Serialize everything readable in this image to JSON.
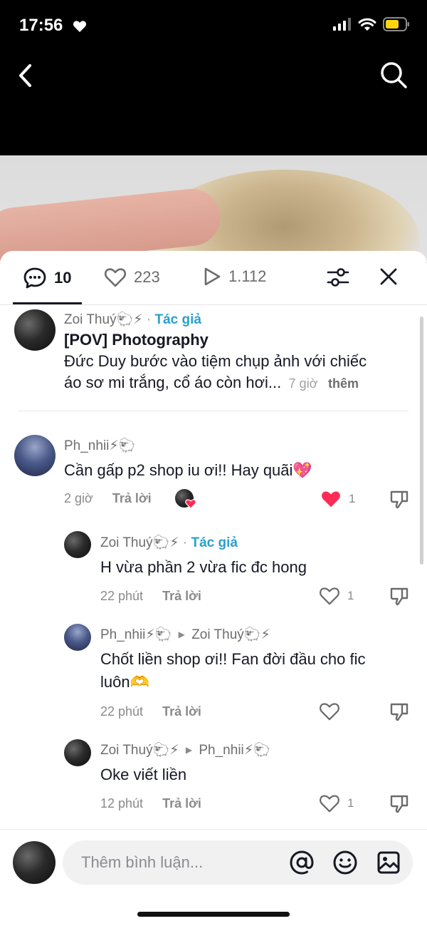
{
  "status_bar": {
    "time": "17:56"
  },
  "tabs": {
    "comments_count": "10",
    "likes_count": "223",
    "views_count": "1.112"
  },
  "post": {
    "author": "Zoi Thuý🐑⚡",
    "author_badge": "Tác giả",
    "title": "[POV]  Photography",
    "body_line1": "Đức Duy bước vào tiệm chụp ảnh với chiếc",
    "body_line2": "áo sơ mi trắng, cổ áo còn hơi...",
    "time": "7 giờ",
    "more": "thêm"
  },
  "comments": [
    {
      "user": "Ph_nhii⚡🐑",
      "text": "Cần gấp p2 shop iu ơi!! Hay quãi💖",
      "time": "2 giờ",
      "reply_label": "Trả lời",
      "likes": "1",
      "liked": true
    },
    {
      "user": "Zoi Thuý🐑⚡",
      "badge": "Tác giả",
      "text": "H vừa phần 2 vừa fic đc hong",
      "time": "22 phút",
      "reply_label": "Trả lời",
      "likes": "1"
    },
    {
      "user": "Ph_nhii⚡🐑",
      "reply_to": "Zoi Thuý🐑⚡",
      "text_line1": "Chốt liền shop ơi!! Fan đời đầu cho fic",
      "text_line2": "luôn🫶",
      "time": "22 phút",
      "reply_label": "Trả lời"
    },
    {
      "user": "Zoi Thuý🐑⚡",
      "reply_to": "Ph_nhii⚡🐑",
      "text": "Oke viết liền",
      "time": "12 phút",
      "reply_label": "Trả lời",
      "likes": "1"
    }
  ],
  "input": {
    "placeholder": "Thêm bình luận..."
  },
  "icons": [
    "heart-icon",
    "wifi-icon",
    "battery-icon",
    "back-icon",
    "search-icon",
    "comment-icon",
    "play-icon",
    "filter-icon",
    "close-icon",
    "dislike-icon",
    "at-icon",
    "emoji-icon",
    "image-icon"
  ],
  "colors": {
    "author_badge": "#2b9fcf",
    "liked_heart": "#fe2c55",
    "battery": "#ffd60a"
  }
}
